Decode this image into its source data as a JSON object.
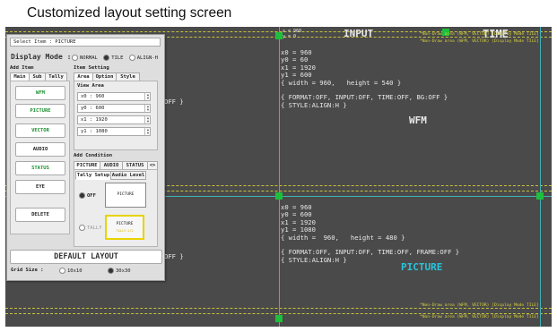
{
  "caption": "Customized layout setting screen",
  "preview": {
    "input_label": "INPUT",
    "time_label": "TIME",
    "top_xy": "x = 960\ny = 0",
    "nondraw_1": "*Non-Draw area (WFM, VECTOR) [Display Mode TILE]",
    "nondraw_2": "*Non-Draw area (WFM, VECTOR) [Display Mode TILE]",
    "nondraw_3": "*Non-Draw area (WFM, VECTOR) [Display Mode TILE]",
    "nondraw_4": "*Non-Draw area (WFM, VECTOR) [Display Mode TILE]",
    "wfm_info": "x0 = 960\ny0 = 60\nx1 = 1920\ny1 = 600\n{ width = 960,   height = 540 }\n\n{ FORMAT:OFF, INPUT:OFF, TIME:OFF, BG:OFF }\n{ STYLE:ALIGN:H }",
    "wfm_label": "WFM",
    "left_off_1": "OFF }",
    "picture_info": "x0 = 960\ny0 = 600\nx1 = 1920\ny1 = 1080\n{ width =  960,   height = 480 }\n\n{ FORMAT:OFF, INPUT:OFF, TIME:OFF, FRAME:OFF }\n{ STYLE:ALIGN:H }",
    "picture_label": "PICTURE",
    "left_off_2": "OFF }"
  },
  "panel": {
    "select_item_label": "Select Item : PICTURE",
    "display_mode_label": "Display Mode :",
    "mode_normal": "NORMAL",
    "mode_tile": "TILE",
    "mode_align_h": "ALIGN-H",
    "add_item_label": "Add Item",
    "item_setting_label": "Item Setting",
    "item_tabs": [
      "Main",
      "Sub",
      "Tally"
    ],
    "items": [
      "WFM",
      "PICTURE",
      "VECTOR",
      "AUDIO",
      "STATUS",
      "EYE"
    ],
    "delete_label": "DELETE",
    "setting_tabs": [
      "Area",
      "Option",
      "Style"
    ],
    "view_area_label": "View Area",
    "fields": [
      "x0 : 960",
      "y0 : 600",
      "x1 : 1920",
      "y1 : 1080"
    ],
    "add_condition_label": "Add Condition",
    "cond_tabs": [
      "PICTURE",
      "AUDIO",
      "STATUS"
    ],
    "cond_more": "<>",
    "sub_tabs": [
      "Tally Setup",
      "Audio Level"
    ],
    "off_label": "OFF",
    "tally_label": "TALLY",
    "off_preview": "PICTURE",
    "tally_preview": "PICTURE",
    "tally_preview_sub": "TALLY:1/2",
    "default_layout_label": "DEFAULT LAYOUT",
    "grid_size_label": "Grid Size :",
    "grid_10": "10x10",
    "grid_30": "30x30"
  }
}
